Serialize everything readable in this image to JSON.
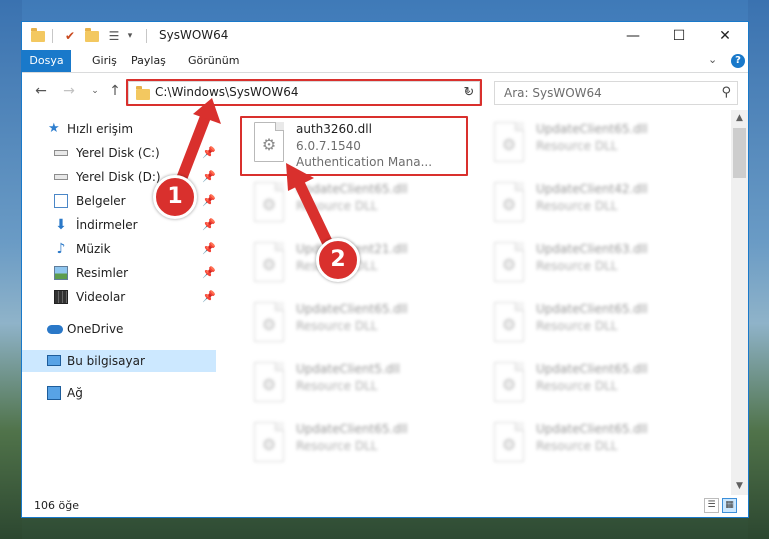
{
  "window": {
    "title": "SysWOW64",
    "minimize_glyph": "—",
    "maximize_glyph": "☐",
    "close_glyph": "✕"
  },
  "ribbon": {
    "tabs": [
      "Dosya",
      "Giriş",
      "Paylaş",
      "Görünüm"
    ],
    "help_label": "?"
  },
  "address": {
    "path": "C:\\Windows\\SysWOW64",
    "search_placeholder": "Ara: SysWOW64"
  },
  "nav": {
    "quick_access": "Hızlı erişim",
    "items": [
      {
        "label": "Yerel Disk (C:)",
        "icon": "drive-icon",
        "pinned": true
      },
      {
        "label": "Yerel Disk (D:)",
        "icon": "drive-icon",
        "pinned": true
      },
      {
        "label": "Belgeler",
        "icon": "documents-icon",
        "pinned": true
      },
      {
        "label": "İndirmeler",
        "icon": "downloads-icon",
        "pinned": true
      },
      {
        "label": "Müzik",
        "icon": "music-icon",
        "pinned": true
      },
      {
        "label": "Resimler",
        "icon": "pictures-icon",
        "pinned": true
      },
      {
        "label": "Videolar",
        "icon": "videos-icon",
        "pinned": true
      }
    ],
    "onedrive": "OneDrive",
    "this_pc": "Bu bilgisayar",
    "network": "Ağ"
  },
  "files": {
    "highlighted": {
      "name": "auth3260.dll",
      "version": "6.0.7.1540",
      "description": "Authentication Mana..."
    },
    "others": [
      {
        "name": "UpdateClient65.dll",
        "type": "Resource DLL"
      },
      {
        "name": "UpdateClient65.dll",
        "type": "Resource DLL"
      },
      {
        "name": "UpdateClient42.dll",
        "type": "Resource DLL"
      },
      {
        "name": "UpdateClient21.dll",
        "type": "Resource DLL"
      },
      {
        "name": "UpdateClient63.dll",
        "type": "Resource DLL"
      },
      {
        "name": "UpdateClient65.dll",
        "type": "Resource DLL"
      },
      {
        "name": "UpdateClient65.dll",
        "type": "Resource DLL"
      },
      {
        "name": "UpdateClient5.dll",
        "type": "Resource DLL"
      },
      {
        "name": "UpdateClient65.dll",
        "type": "Resource DLL"
      },
      {
        "name": "UpdateClient65.dll",
        "type": "Resource DLL"
      },
      {
        "name": "UpdateClient65.dll",
        "type": "Resource DLL"
      }
    ]
  },
  "status": {
    "item_count": "106 öğe"
  },
  "callouts": {
    "step1": "1",
    "step2": "2"
  },
  "colors": {
    "accent": "#1979ca",
    "highlight": "#d9302d",
    "selected_nav": "#cce8ff"
  }
}
